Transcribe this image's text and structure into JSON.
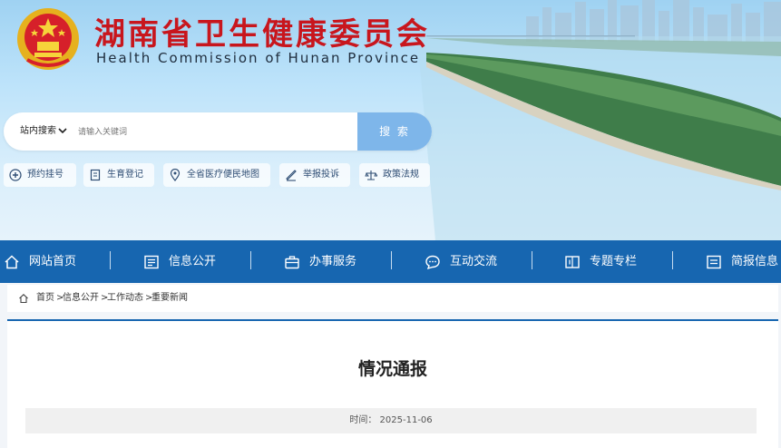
{
  "header": {
    "title": "湖南省卫生健康委员会",
    "subtitle": "Health Commission of Hunan Province"
  },
  "search": {
    "scope": "站内搜索",
    "placeholder": "请输入关键词",
    "button": "搜 索"
  },
  "quick_links": [
    {
      "label": "预约挂号",
      "icon": "hospital-plus-icon"
    },
    {
      "label": "生育登记",
      "icon": "document-icon"
    },
    {
      "label": "全省医疗便民地图",
      "icon": "map-pin-icon"
    },
    {
      "label": "举报投诉",
      "icon": "report-icon"
    },
    {
      "label": "政策法规",
      "icon": "scale-icon"
    }
  ],
  "nav": [
    {
      "label": "网站首页",
      "icon": "home-icon"
    },
    {
      "label": "信息公开",
      "icon": "info-list-icon"
    },
    {
      "label": "办事服务",
      "icon": "briefcase-icon"
    },
    {
      "label": "互动交流",
      "icon": "chat-icon"
    },
    {
      "label": "专题专栏",
      "icon": "topic-icon"
    },
    {
      "label": "简报信息",
      "icon": "brief-icon"
    }
  ],
  "breadcrumb": {
    "items": [
      "首页",
      "信息公开",
      "工作动态",
      "重要新闻"
    ],
    "separator": ">"
  },
  "article": {
    "title": "情况通报",
    "meta_label": "时间：",
    "date": "2025-11-06"
  },
  "colors": {
    "title_red": "#c8161d",
    "nav_blue": "#1766b0",
    "search_button": "#7eb6ea"
  }
}
